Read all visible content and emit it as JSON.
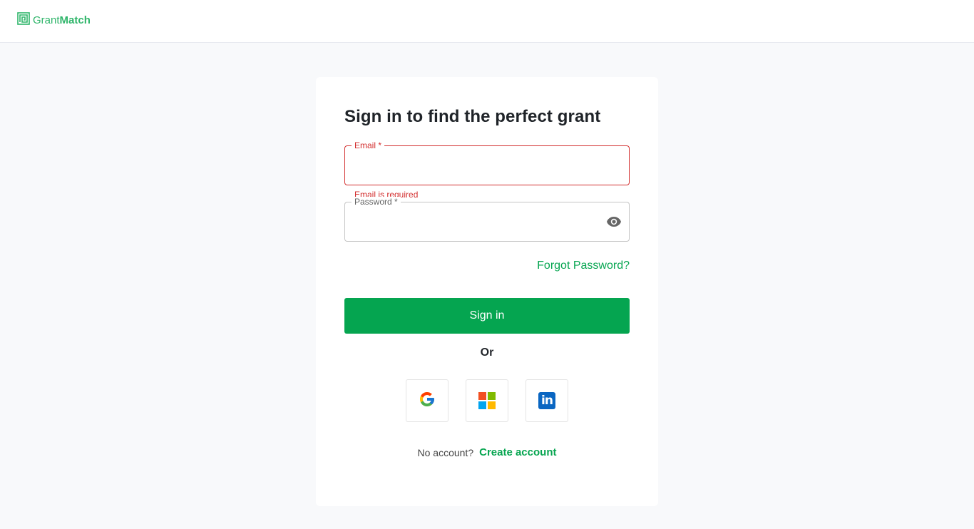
{
  "header": {
    "logo_light": "Grant",
    "logo_bold": "Match",
    "logo_icon": "maze-logo-icon"
  },
  "form": {
    "title": "Sign in to find the perfect grant",
    "email_label": "Email *",
    "email_value": "",
    "email_error": "Email is required",
    "password_label": "Password *",
    "password_value": "",
    "show_password_icon": "eye-icon",
    "forgot_label": "Forgot Password?",
    "signin_label": "Sign in",
    "or_label": "Or"
  },
  "social": {
    "providers": [
      {
        "name": "google",
        "icon": "google-icon"
      },
      {
        "name": "microsoft",
        "icon": "microsoft-icon"
      },
      {
        "name": "linkedin",
        "icon": "linkedin-icon",
        "glyph": "in"
      }
    ]
  },
  "footer": {
    "no_account": "No account?",
    "create_label": "Create account"
  },
  "colors": {
    "brand_green": "#05a550",
    "error_red": "#d32f2f",
    "linkedin_blue": "#0a66c2"
  }
}
